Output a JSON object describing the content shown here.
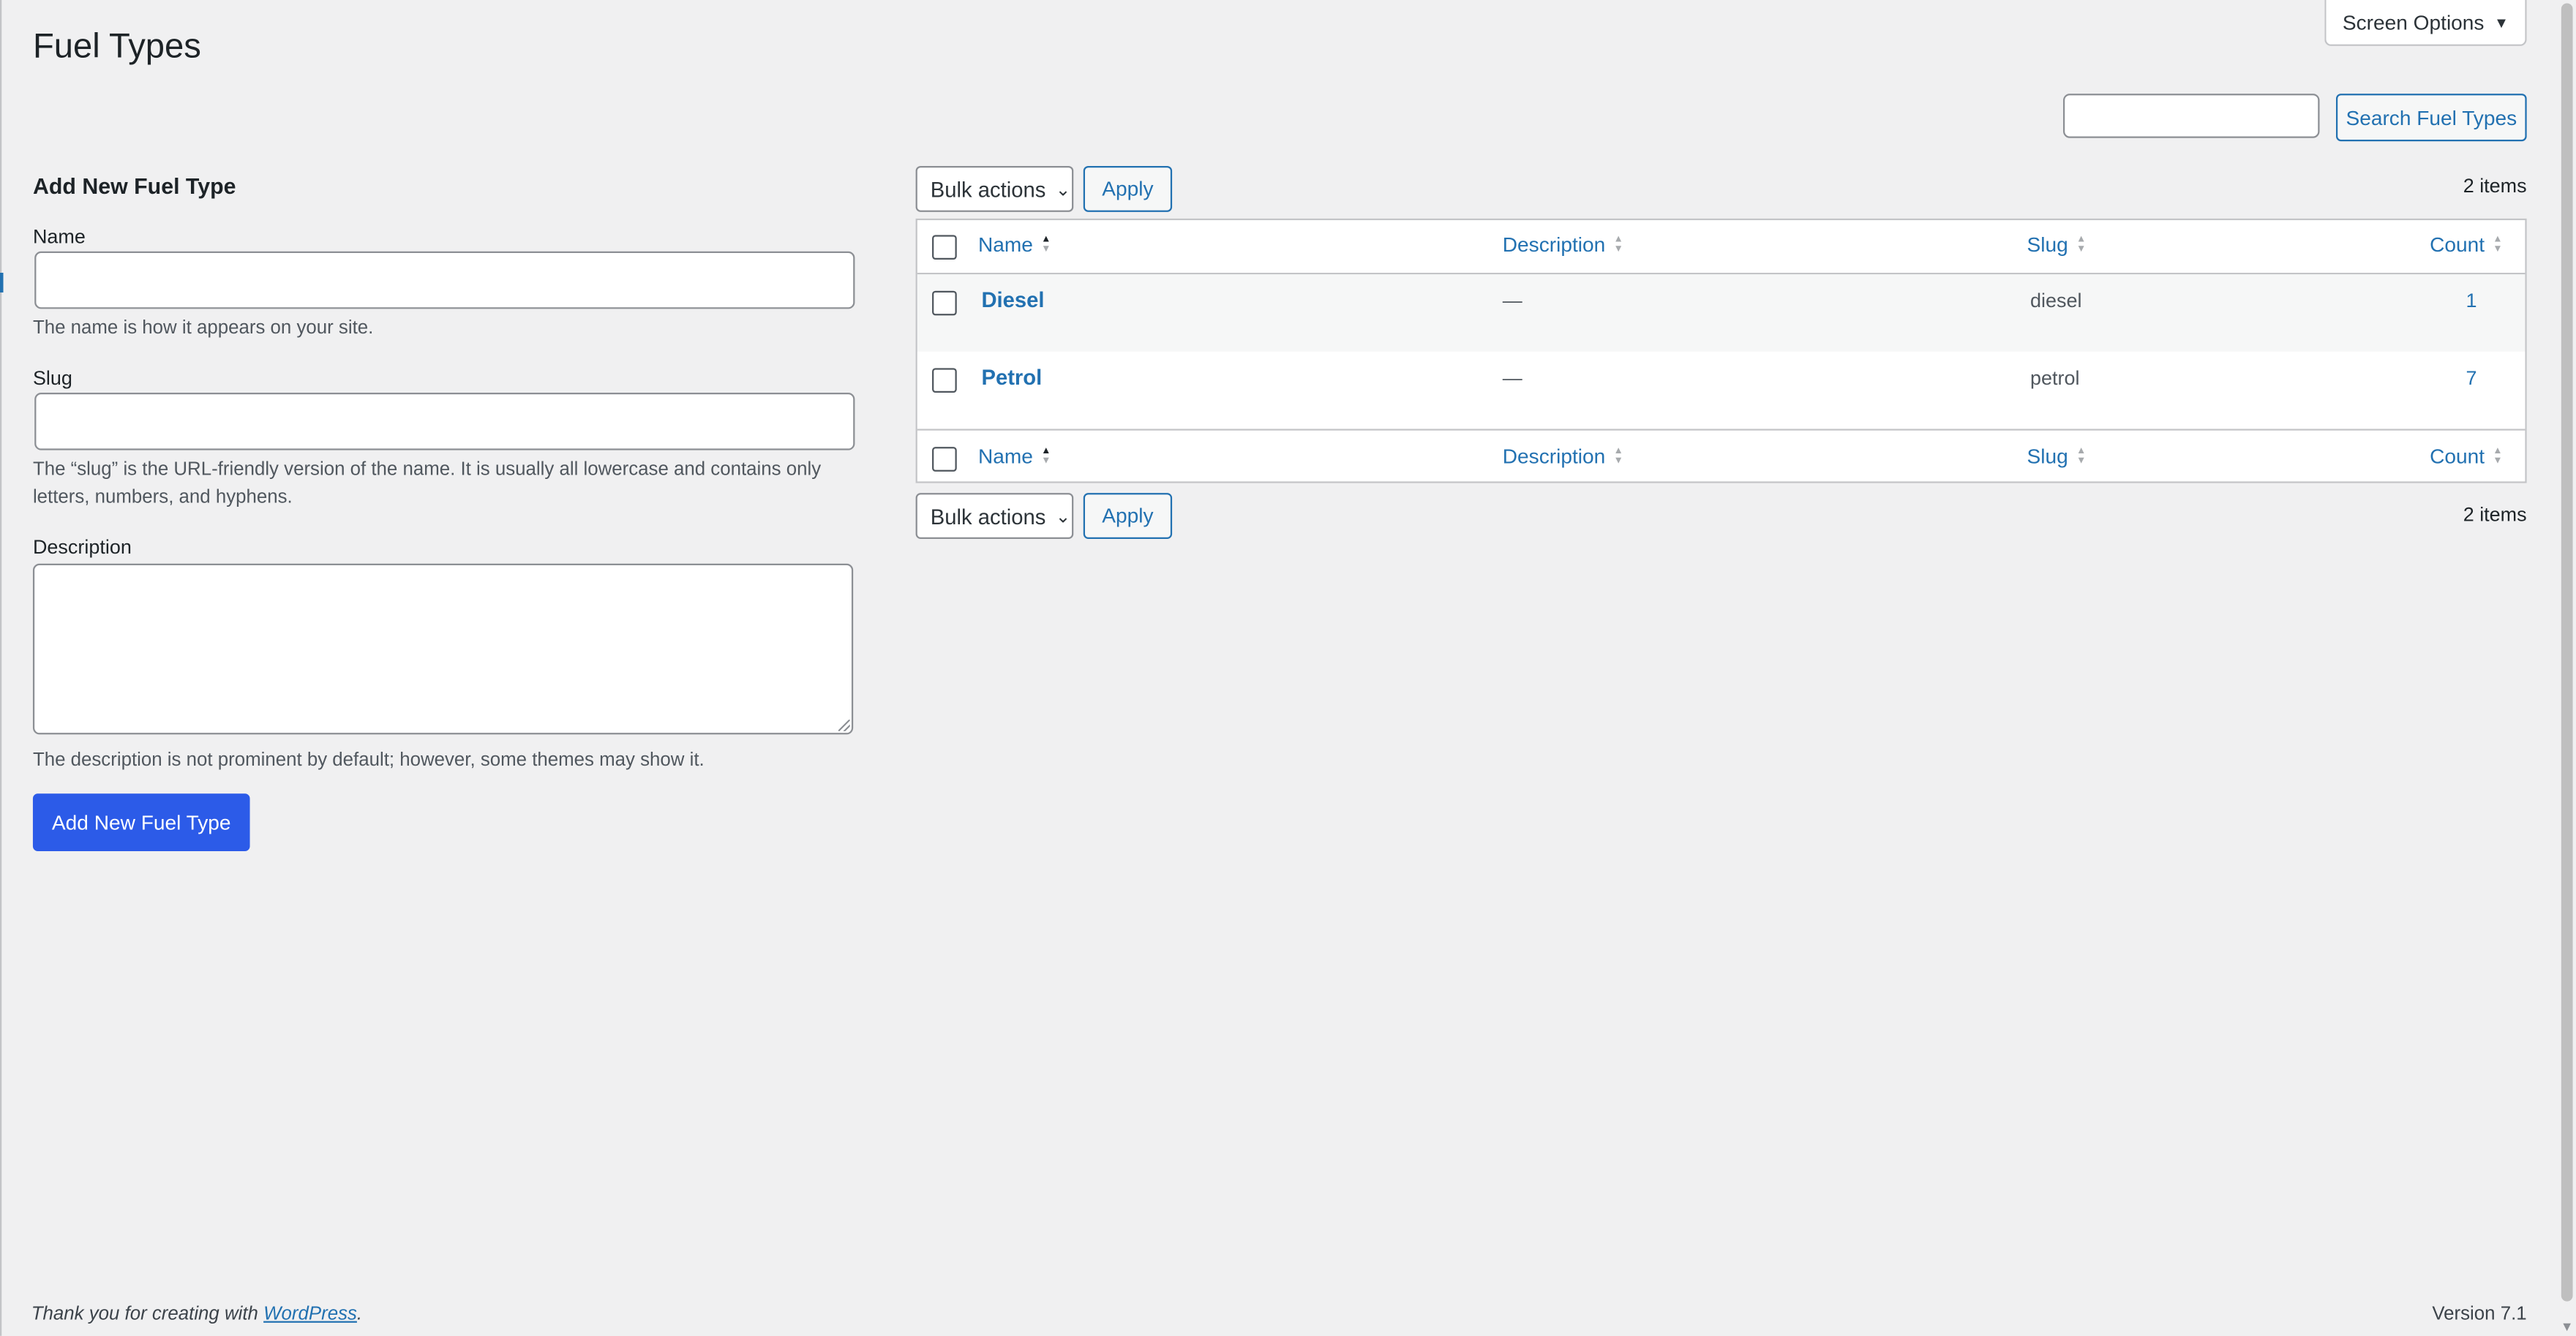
{
  "page": {
    "title": "Fuel Types"
  },
  "screen_options": {
    "label": "Screen Options",
    "icon": "triangle-down-icon"
  },
  "search": {
    "value": "",
    "button_label": "Search Fuel Types"
  },
  "form": {
    "title": "Add New Fuel Type",
    "name_label": "Name",
    "name_value": "",
    "name_help": "The name is how it appears on your site.",
    "slug_label": "Slug",
    "slug_value": "",
    "slug_help": "The “slug” is the URL-friendly version of the name. It is usually all lowercase and contains only letters, numbers, and hyphens.",
    "description_label": "Description",
    "description_value": "",
    "description_help": "The description is not prominent by default; however, some themes may show it.",
    "submit_label": "Add New Fuel Type"
  },
  "toolbar": {
    "bulk_label": "Bulk actions",
    "apply_label": "Apply",
    "items_count": "2 items"
  },
  "table": {
    "columns": {
      "name": "Name",
      "description": "Description",
      "slug": "Slug",
      "count": "Count"
    },
    "rows": [
      {
        "name": "Diesel",
        "description": "—",
        "slug": "diesel",
        "count": "1"
      },
      {
        "name": "Petrol",
        "description": "—",
        "slug": "petrol",
        "count": "7"
      }
    ]
  },
  "footer": {
    "thanks_prefix": "Thank you for creating with ",
    "thanks_link": "WordPress",
    "thanks_suffix": ".",
    "version": "Version 7.1"
  },
  "colors": {
    "link": "#2271b1",
    "primary_button": "#2c5be8",
    "background": "#f0f0f1"
  }
}
